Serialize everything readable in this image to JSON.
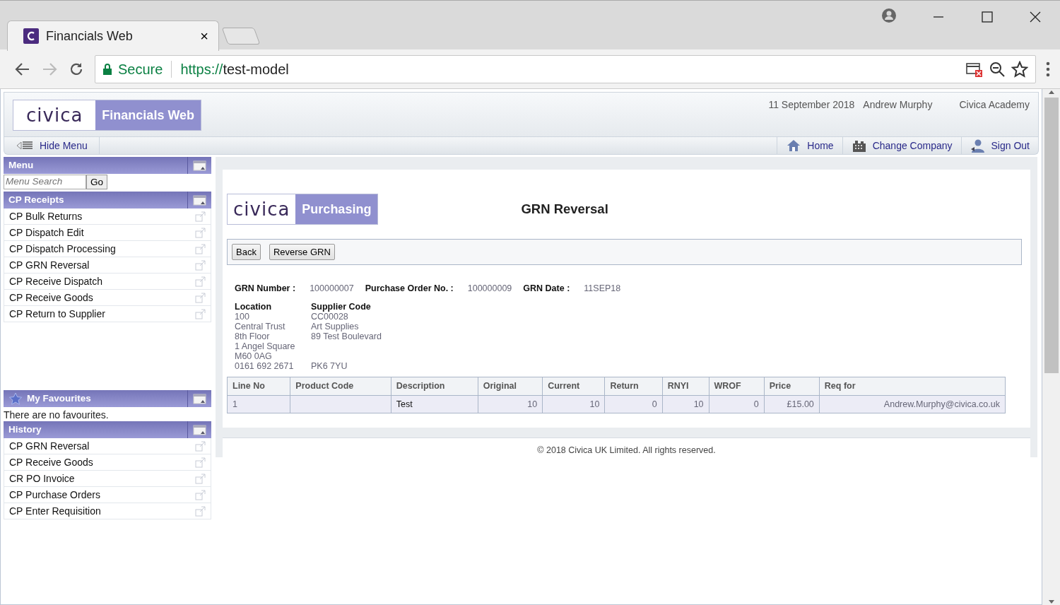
{
  "browser": {
    "tab_title": "Financials Web",
    "tab_close": "×",
    "secure_label": "Secure",
    "url_scheme": "https://",
    "url_host": "test-model"
  },
  "header": {
    "logo_brand": "civica",
    "logo_text": "Financials Web",
    "date": "11 September 2018",
    "user": "Andrew Murphy",
    "company": "Civica Academy"
  },
  "menu_bar": {
    "hide_menu": "Hide Menu",
    "links": [
      {
        "kind": "home",
        "label": "Home"
      },
      {
        "kind": "company",
        "label": "Change Company"
      },
      {
        "kind": "signout",
        "label": "Sign Out"
      }
    ]
  },
  "sidebar": {
    "menu_title": "Menu",
    "search_placeholder": "Menu Search",
    "go": "Go",
    "sections": [
      {
        "kind": "list",
        "title": "CP Receipts",
        "items": [
          "CP Bulk Returns",
          "CP Dispatch Edit",
          "CP Dispatch Processing",
          "CP GRN Reversal",
          "CP Receive Dispatch",
          "CP Receive Goods",
          "CP Return to Supplier"
        ]
      },
      {
        "kind": "favourites",
        "title": "My Favourites",
        "empty_text": "There are no favourites."
      },
      {
        "kind": "list",
        "title": "History",
        "items": [
          "CP GRN Reversal",
          "CP Receive Goods",
          "CR PO Invoice",
          "CP Purchase Orders",
          "CP Enter Requisition"
        ]
      }
    ]
  },
  "content": {
    "logo_brand": "civica",
    "logo_text": "Purchasing",
    "page_title": "GRN Reversal",
    "buttons": [
      "Back",
      "Reverse GRN"
    ],
    "fields": [
      {
        "label": "GRN Number  :",
        "value": "100000007"
      },
      {
        "label": "Purchase Order No.  :",
        "value": "100000009"
      },
      {
        "label": "GRN Date :",
        "value": "11SEP18"
      }
    ],
    "addresses": [
      {
        "heading": "Location",
        "lines": [
          "100",
          "Central Trust",
          "8th Floor",
          "1 Angel Square",
          "M60 0AG"
        ],
        "last_line": "0161 692 2671"
      },
      {
        "heading": "Supplier Code",
        "lines": [
          "CC00028",
          "Art Supplies",
          "89 Test Boulevard"
        ],
        "last_line": "PK6 7YU"
      }
    ],
    "table": {
      "columns": [
        {
          "label": "Line No",
          "kind": "text"
        },
        {
          "label": "Product Code",
          "kind": "text"
        },
        {
          "label": "Description",
          "kind": "description"
        },
        {
          "label": "Original",
          "kind": "number"
        },
        {
          "label": "Current",
          "kind": "number"
        },
        {
          "label": "Return",
          "kind": "number"
        },
        {
          "label": "RNYI",
          "kind": "number"
        },
        {
          "label": "WROF",
          "kind": "number"
        },
        {
          "label": "Price",
          "kind": "number"
        },
        {
          "label": "Req for",
          "kind": "number"
        }
      ],
      "rows": [
        [
          "1",
          "",
          "Test",
          "10",
          "10",
          "0",
          "10",
          "0",
          "£15.00",
          "Andrew.Murphy@civica.co.uk"
        ]
      ]
    }
  },
  "footer": "© 2018 Civica UK Limited. All rights reserved."
}
